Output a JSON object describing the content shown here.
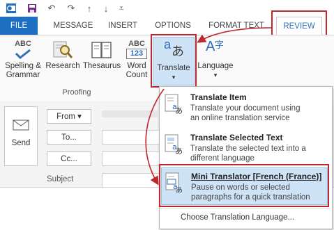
{
  "tabs": [
    "FILE",
    "MESSAGE",
    "INSERT",
    "OPTIONS",
    "FORMAT TEXT",
    "REVIEW"
  ],
  "ribbon": {
    "spelling": {
      "icon_text": "ABC",
      "label1": "Spelling &",
      "label2": "Grammar"
    },
    "research": {
      "label": "Research"
    },
    "thesaurus": {
      "label": "Thesaurus"
    },
    "wordcount": {
      "icon_top": "ABC",
      "icon_bottom": "123",
      "label1": "Word",
      "label2": "Count"
    },
    "translate": {
      "icon_a": "a",
      "icon_b": "あ",
      "label": "Translate",
      "arrow": "▾"
    },
    "language": {
      "icon_a": "A",
      "icon_b": "字",
      "label": "Language"
    },
    "group_proofing": "Proofing"
  },
  "mail": {
    "send_label": "Send",
    "from_label": "From ▾",
    "to_label": "To...",
    "cc_label": "Cc...",
    "subject_label": "Subject"
  },
  "dropdown": {
    "items": [
      {
        "title": "Translate Item",
        "desc1": "Translate your document using",
        "desc2": "an online translation service"
      },
      {
        "title": "Translate Selected Text",
        "desc1": "Translate the selected text into a",
        "desc2": "different language"
      },
      {
        "title": "Mini Translator [French (France)]",
        "desc1": "Pause on words or selected",
        "desc2": "paragraphs for a quick translation"
      }
    ],
    "footer": "Choose Translation Language..."
  },
  "colors": {
    "accent_blue": "#1e6fc0",
    "highlight_red": "#c0282d",
    "hover_blue": "#cfe3f7"
  }
}
